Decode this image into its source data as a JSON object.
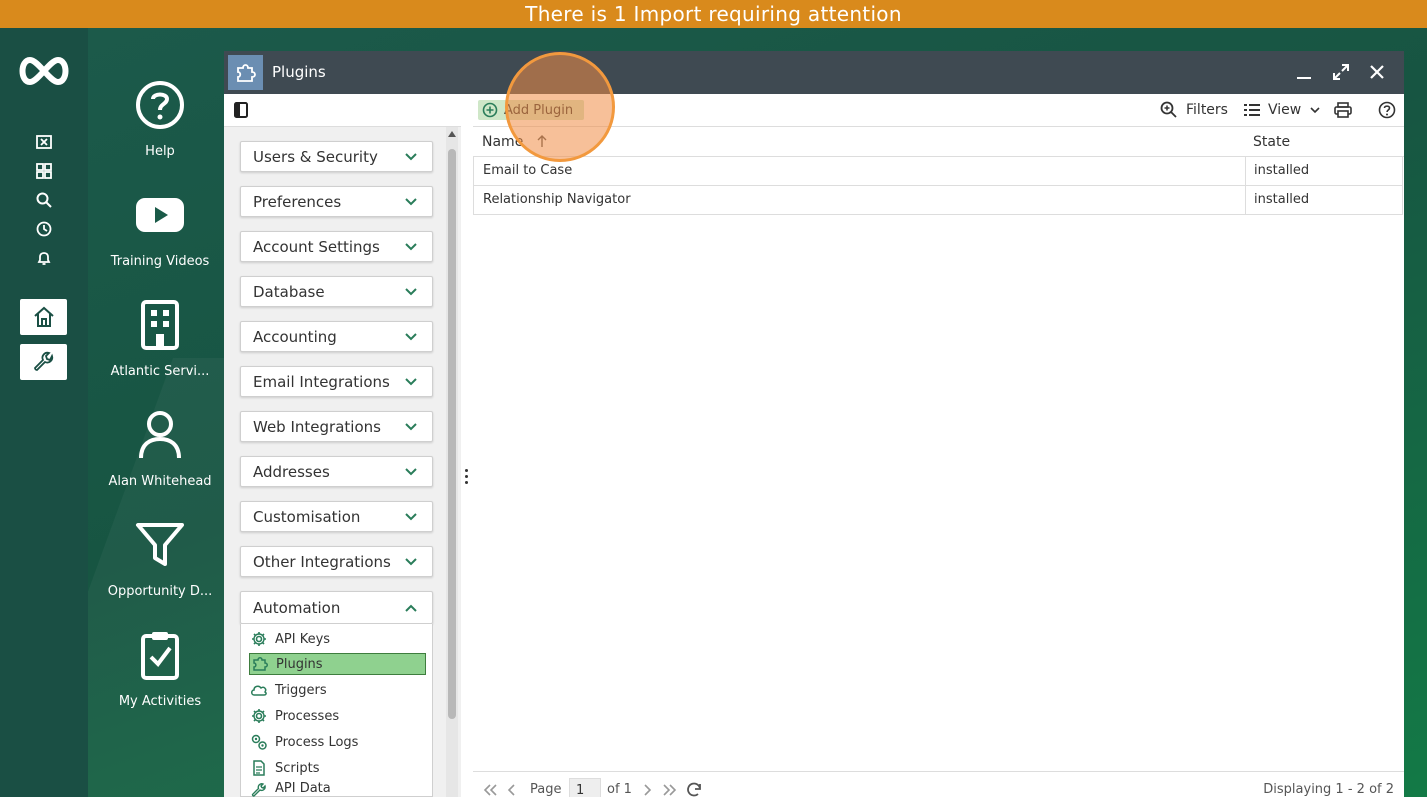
{
  "banner": {
    "text": "There is 1 Import requiring attention"
  },
  "shortcuts": [
    {
      "label": "Help",
      "icon": "help-circle-icon"
    },
    {
      "label": "Training Videos",
      "icon": "youtube-play-icon"
    },
    {
      "label": "Atlantic Servi...",
      "icon": "building-icon"
    },
    {
      "label": "Alan Whitehead",
      "icon": "user-icon"
    },
    {
      "label": "Opportunity D...",
      "icon": "funnel-icon"
    },
    {
      "label": "My Activities",
      "icon": "clipboard-check-icon"
    }
  ],
  "window": {
    "title": "Plugins"
  },
  "sidebar": {
    "sections": [
      {
        "label": "Users & Security"
      },
      {
        "label": "Preferences"
      },
      {
        "label": "Account Settings"
      },
      {
        "label": "Database"
      },
      {
        "label": "Accounting"
      },
      {
        "label": "Email Integrations"
      },
      {
        "label": "Web Integrations"
      },
      {
        "label": "Addresses"
      },
      {
        "label": "Customisation"
      },
      {
        "label": "Other Integrations"
      },
      {
        "label": "Automation"
      }
    ],
    "automation_items": [
      {
        "label": "API Keys",
        "icon": "gear-icon"
      },
      {
        "label": "Plugins",
        "icon": "puzzle-icon"
      },
      {
        "label": "Triggers",
        "icon": "cloud-icon"
      },
      {
        "label": "Processes",
        "icon": "gear-icon"
      },
      {
        "label": "Process Logs",
        "icon": "gears-icon"
      },
      {
        "label": "Scripts",
        "icon": "document-icon"
      },
      {
        "label": "API Data",
        "icon": "wrench-icon"
      }
    ]
  },
  "toolbar": {
    "add_label": "Add Plugin",
    "filters_label": "Filters",
    "view_label": "View"
  },
  "grid": {
    "columns": [
      "Name",
      "State"
    ],
    "rows": [
      {
        "name": "Email to Case",
        "state": "installed"
      },
      {
        "name": "Relationship Navigator",
        "state": "installed"
      }
    ]
  },
  "pager": {
    "page_label": "Page",
    "page_value": "1",
    "of_label": "of 1",
    "display_text": "Displaying 1 - 2 of 2"
  },
  "colors": {
    "banner": "#d98a1c",
    "accent_green": "#2a7d5a",
    "titlebar": "#3f4a52",
    "active_item": "#8fd18f"
  }
}
